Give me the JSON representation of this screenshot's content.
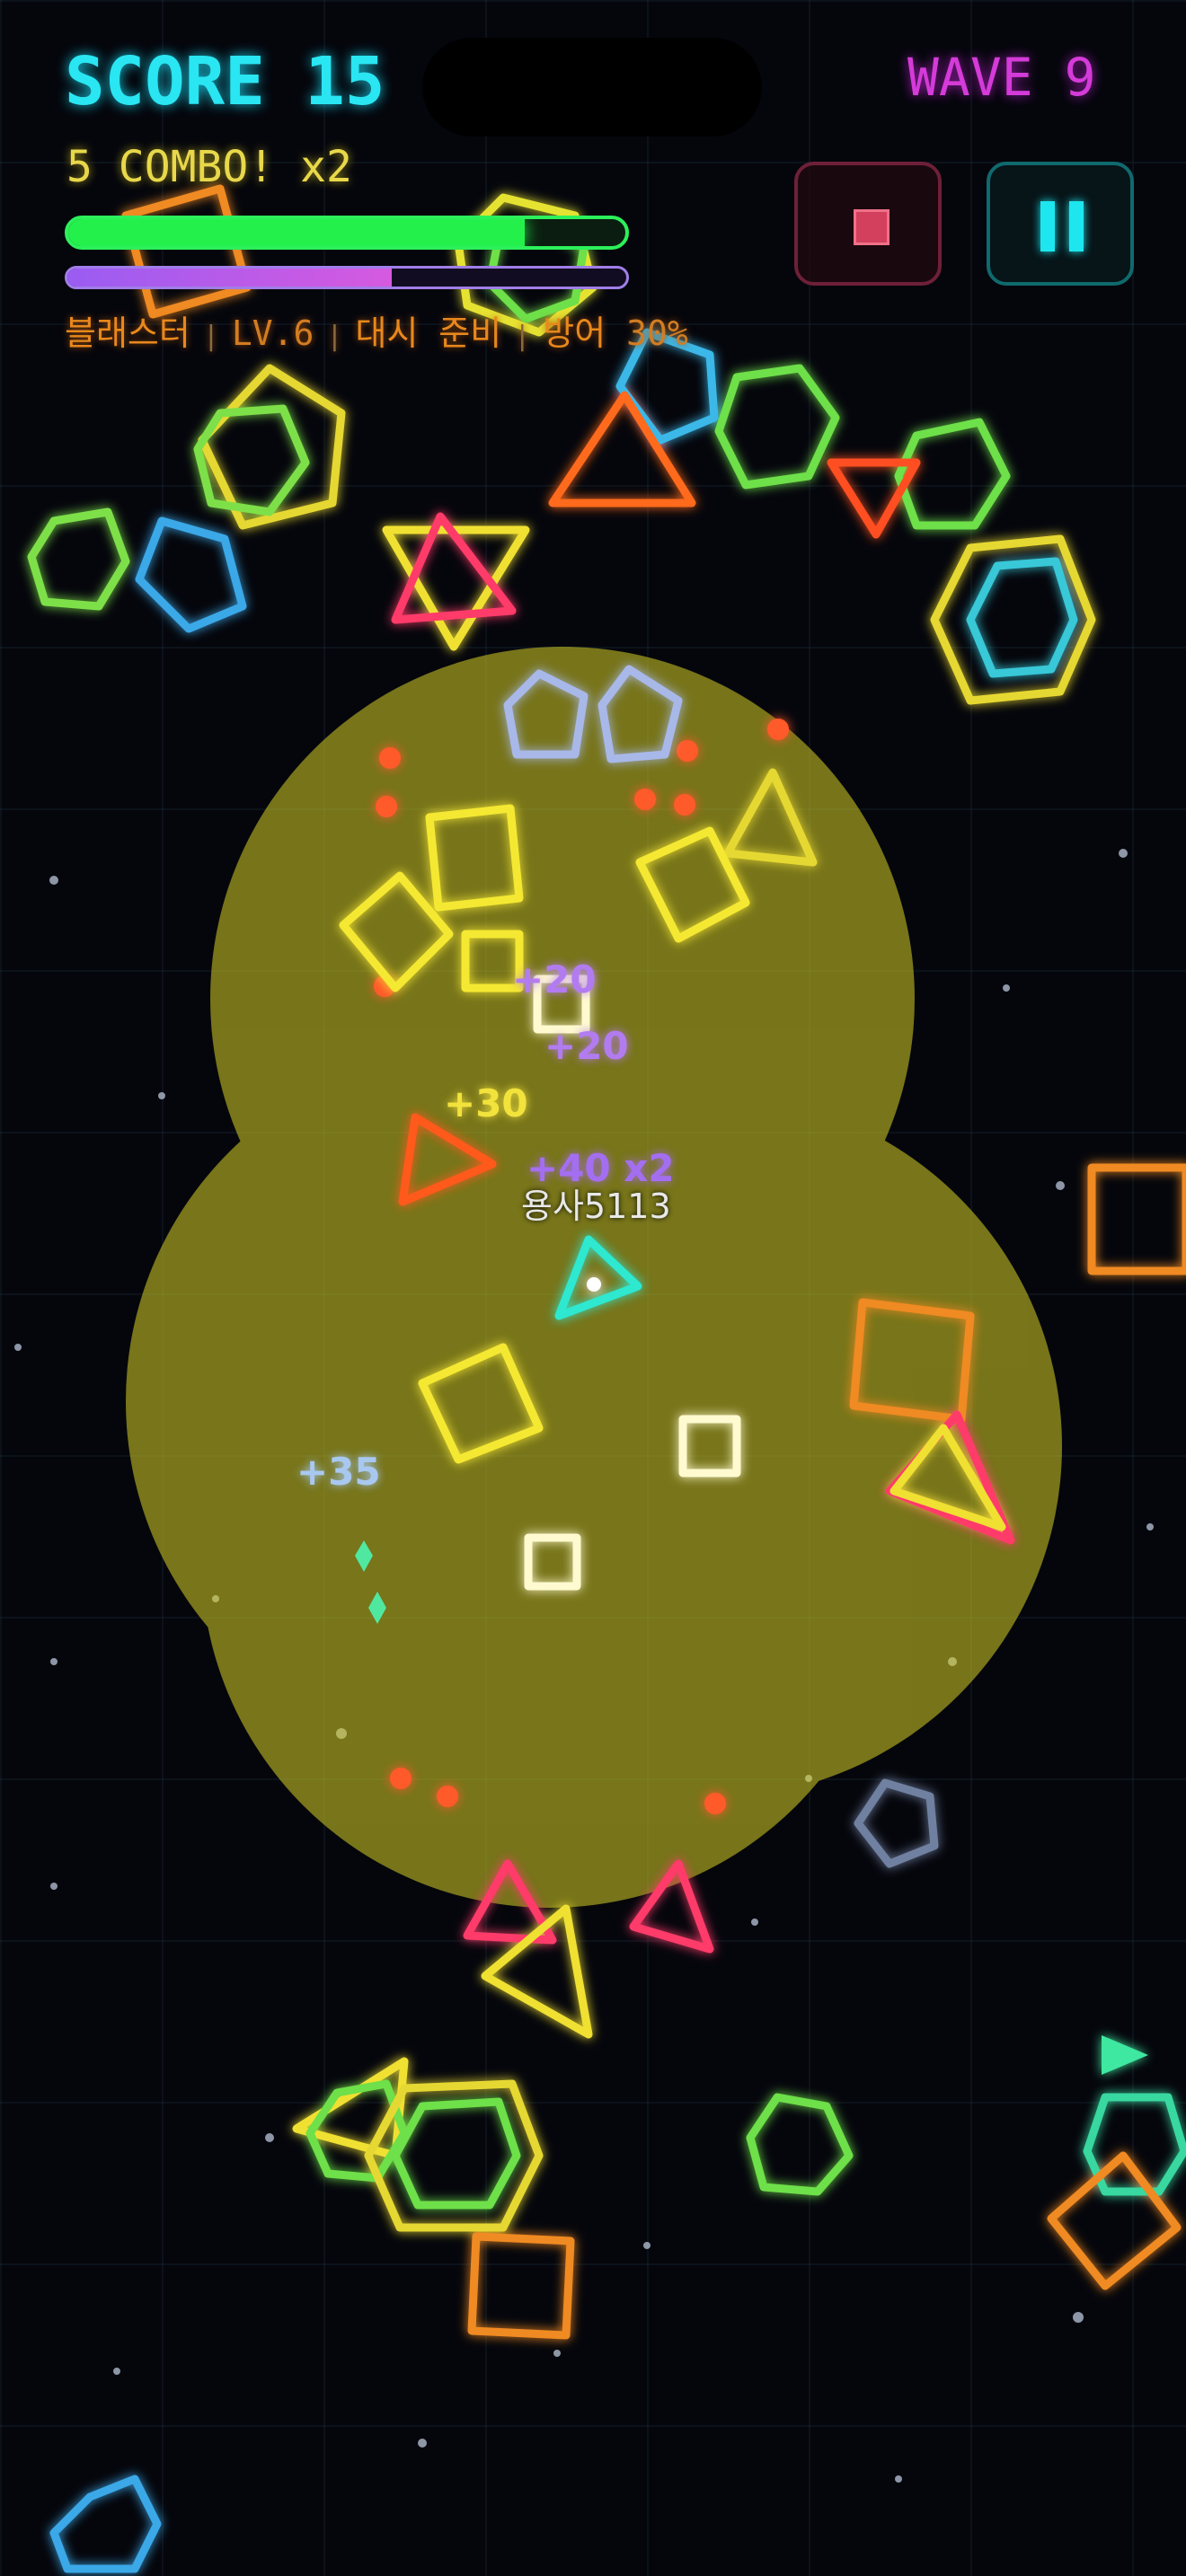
{
  "hud": {
    "score_label": "SCORE 15",
    "wave_label": "WAVE 9",
    "combo_label": "5 COMBO! x2",
    "hp_ratio": 0.82,
    "xp_ratio": 0.58,
    "status": {
      "weapon": "블래스터",
      "level": "LV.6",
      "dash": "대시 준비",
      "shield": "방어",
      "shield_value": "30%",
      "separator": "|"
    }
  },
  "buttons": {
    "stop_icon": "stop-square-icon",
    "pause_icon": "pause-icon"
  },
  "player": {
    "name": "용사5113",
    "color": "#2fe8d0"
  },
  "score_popups": [
    {
      "text": "+20",
      "color": "#b27cf0"
    },
    {
      "text": "+20",
      "color": "#b27cf0"
    },
    {
      "text": "+30",
      "color": "#f2e23c"
    },
    {
      "text": "+40 x2",
      "color": "#a46ef0"
    },
    {
      "text": "+35",
      "color": "#a8c8f0"
    }
  ],
  "colors": {
    "score": "#29e6f2",
    "wave": "#d43bd8",
    "combo": "#e8d84a",
    "hp": "#24f04c",
    "xp": "#b063e8",
    "explosion": "#d6d026"
  }
}
